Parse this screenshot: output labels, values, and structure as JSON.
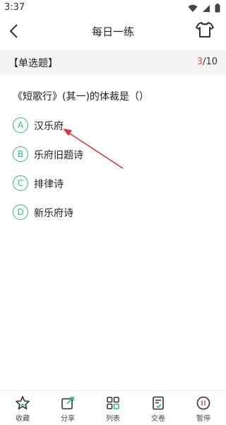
{
  "status_bar": {
    "time": "3:37"
  },
  "header": {
    "title": "每日一练"
  },
  "section": {
    "label": "【单选题】",
    "current": "3",
    "total": "/10"
  },
  "question": {
    "text": "《短歌行》(其一)的体裁是（）"
  },
  "options": [
    {
      "letter": "A",
      "text": "汉乐府"
    },
    {
      "letter": "B",
      "text": "乐府旧题诗"
    },
    {
      "letter": "C",
      "text": "排律诗"
    },
    {
      "letter": "D",
      "text": "新乐府诗"
    }
  ],
  "bottom_bar": {
    "items": [
      {
        "label": "收藏",
        "icon": "star-icon"
      },
      {
        "label": "分享",
        "icon": "share-icon"
      },
      {
        "label": "列表",
        "icon": "grid-icon"
      },
      {
        "label": "交卷",
        "icon": "submit-icon"
      },
      {
        "label": "暂停",
        "icon": "pause-icon"
      }
    ]
  },
  "colors": {
    "accent": "#2dbb8b",
    "highlight": "#e0524b",
    "annotation_arrow": "#d9363e"
  }
}
